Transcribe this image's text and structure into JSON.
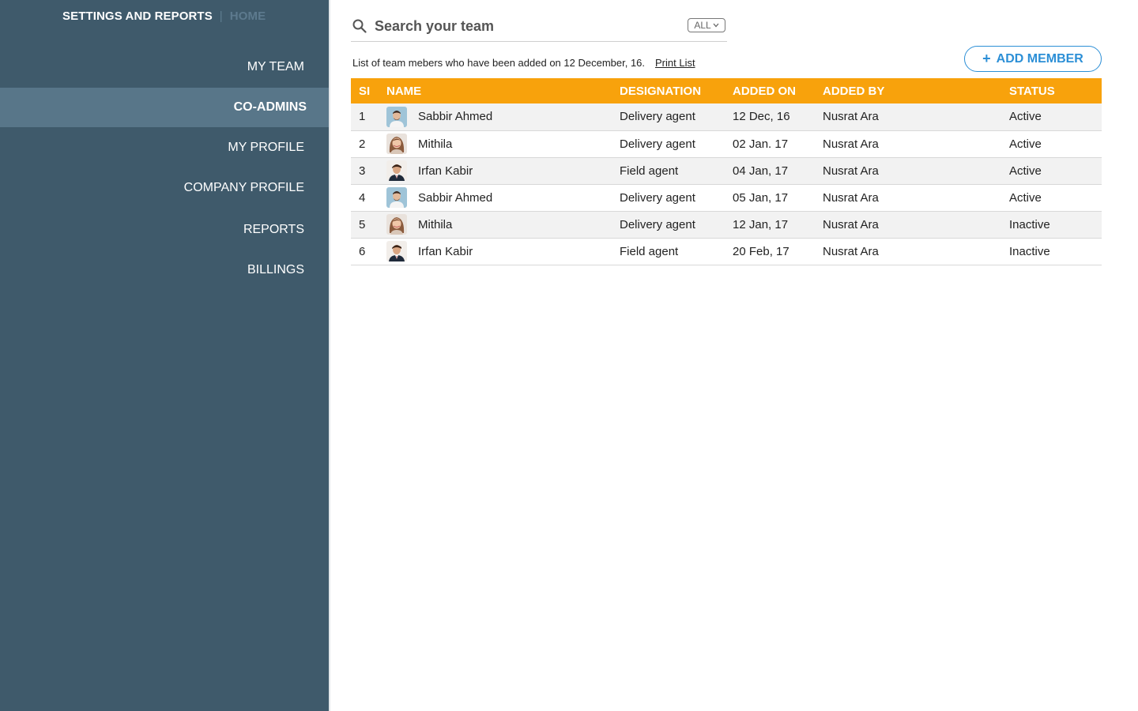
{
  "app": {
    "title": "SETTINGS AND REPORTS",
    "separator": "|",
    "home_label": "HOME"
  },
  "sidebar": {
    "items": [
      {
        "label": "MY TEAM",
        "active": false
      },
      {
        "label": "CO-ADMINS",
        "active": true
      },
      {
        "label": "MY PROFILE",
        "active": false
      },
      {
        "label": "COMPANY PROFILE",
        "active": false
      },
      {
        "label": "REPORTS",
        "active": false
      },
      {
        "label": "BILLINGS",
        "active": false
      }
    ]
  },
  "search": {
    "value": "",
    "placeholder": "Search your team",
    "icon": "search-icon",
    "filter": {
      "selected": "ALL",
      "icon": "chevron-down-icon"
    }
  },
  "info": {
    "text": "List of team mebers who have been added on 12 December, 16.",
    "print_label": "Print List"
  },
  "add_member": {
    "plus": "+",
    "label": "ADD MEMBER"
  },
  "table": {
    "columns": [
      "SI",
      "NAME",
      "DESIGNATION",
      "ADDED ON",
      "ADDED BY",
      "STATUS"
    ],
    "rows": [
      {
        "si": "1",
        "name": "Sabbir Ahmed",
        "avatar": "avatar-man-blue-bg-icon",
        "designation": "Delivery agent",
        "added_on": "12 Dec, 16",
        "added_by": "Nusrat Ara",
        "status": "Active"
      },
      {
        "si": "2",
        "name": "Mithila",
        "avatar": "avatar-woman-icon",
        "designation": "Delivery agent",
        "added_on": "02 Jan. 17",
        "added_by": "Nusrat Ara",
        "status": "Active"
      },
      {
        "si": "3",
        "name": "Irfan Kabir",
        "avatar": "avatar-man-suit-icon",
        "designation": "Field agent",
        "added_on": "04 Jan, 17",
        "added_by": "Nusrat Ara",
        "status": "Active"
      },
      {
        "si": "4",
        "name": "Sabbir Ahmed",
        "avatar": "avatar-man-blue-bg-icon",
        "designation": "Delivery agent",
        "added_on": "05 Jan, 17",
        "added_by": "Nusrat Ara",
        "status": "Active"
      },
      {
        "si": "5",
        "name": "Mithila",
        "avatar": "avatar-woman-icon",
        "designation": "Delivery agent",
        "added_on": "12 Jan, 17",
        "added_by": "Nusrat Ara",
        "status": "Inactive"
      },
      {
        "si": "6",
        "name": "Irfan Kabir",
        "avatar": "avatar-man-suit-icon",
        "designation": "Field agent",
        "added_on": "20 Feb, 17",
        "added_by": "Nusrat Ara",
        "status": "Inactive"
      }
    ]
  },
  "colors": {
    "sidebar_bg": "#3f5a6b",
    "sidebar_active_bg": "#587689",
    "header_orange": "#f8a20c",
    "accent_blue": "#2c8fd6"
  }
}
